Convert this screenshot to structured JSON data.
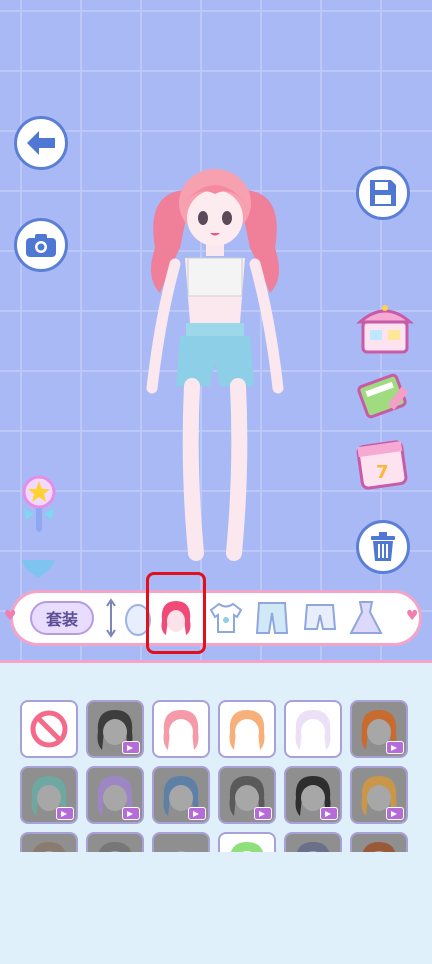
{
  "toolbar": {
    "outfit_label": "套装"
  },
  "tabs": [
    {
      "name": "skin",
      "icon": "egg-icon"
    },
    {
      "name": "hair",
      "icon": "hair-icon",
      "selected": true
    },
    {
      "name": "top",
      "icon": "tshirt-icon"
    },
    {
      "name": "pants",
      "icon": "pants-icon"
    },
    {
      "name": "shorts",
      "icon": "shorts-icon"
    },
    {
      "name": "dress",
      "icon": "dress-icon"
    }
  ],
  "colors": {
    "accent_pink": "#f2a5c8",
    "button_blue": "#5b7fd6",
    "highlight_red": "#e0101c",
    "ad_purple": "#b66bd8"
  },
  "hair_items": [
    {
      "type": "none",
      "icon": "no-entry-icon"
    },
    {
      "type": "locked",
      "color": "#3d3d3d",
      "ad": true
    },
    {
      "type": "free",
      "color": "#f59aa8"
    },
    {
      "type": "free",
      "color": "#f7b07a"
    },
    {
      "type": "free",
      "color": "#ece0f6"
    },
    {
      "type": "locked",
      "color": "#c86b2e",
      "ad": true
    },
    {
      "type": "locked",
      "color": "#6ea8a0",
      "ad": true
    },
    {
      "type": "locked",
      "color": "#9d86c4",
      "ad": true
    },
    {
      "type": "locked",
      "color": "#5e7fa6",
      "ad": true
    },
    {
      "type": "locked",
      "color": "#5a5a5a",
      "ad": true
    },
    {
      "type": "locked",
      "color": "#2e2e2e",
      "ad": true
    },
    {
      "type": "locked",
      "color": "#c9964a",
      "ad": true
    },
    {
      "type": "locked",
      "color": "#8a7b70",
      "ad": true
    },
    {
      "type": "locked",
      "color": "#777777",
      "ad": true
    },
    {
      "type": "locked",
      "color": "#8f8f8f",
      "ad": true
    },
    {
      "type": "free",
      "color": "#8fe07a"
    },
    {
      "type": "locked",
      "color": "#6a6f8a",
      "ad": true
    },
    {
      "type": "locked",
      "color": "#9a5a3a",
      "ad": true
    }
  ]
}
